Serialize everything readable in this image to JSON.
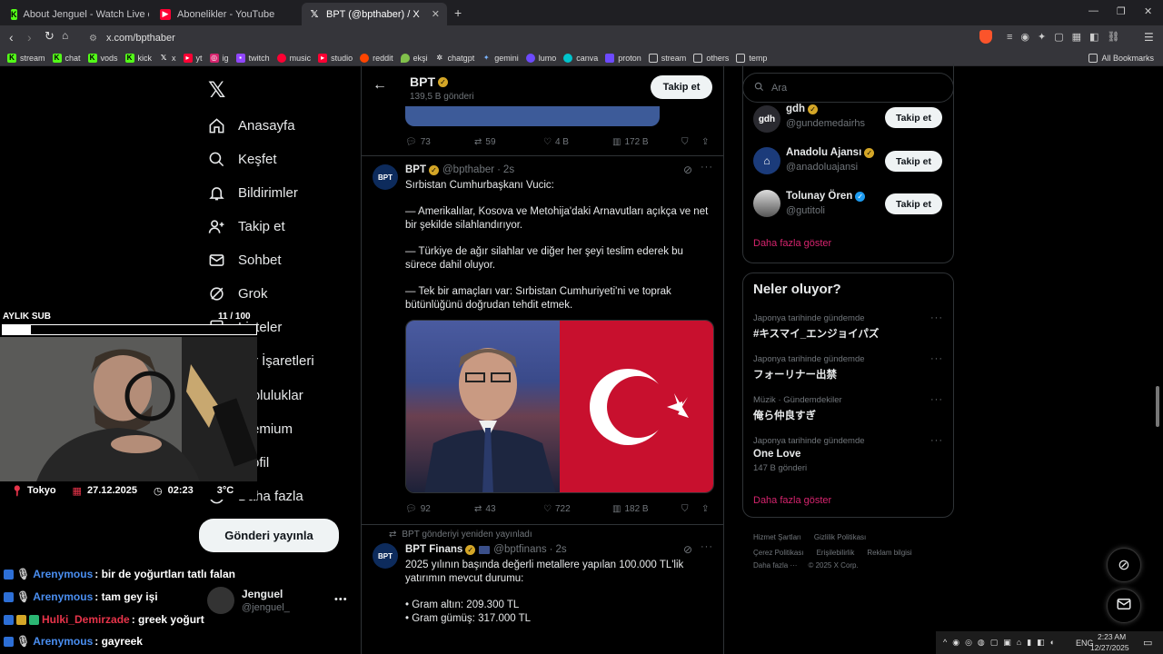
{
  "browser": {
    "tabs": [
      {
        "title": "About Jenguel - Watch Live on Kick",
        "icon": "kick-icon",
        "color": "#53fc18"
      },
      {
        "title": "Abonelikler - YouTube",
        "icon": "youtube-icon",
        "color": "#ff0033"
      },
      {
        "title": "BPT (@bpthaber) / X",
        "icon": "x-icon",
        "color": "#ffffff"
      }
    ],
    "url": "x.com/bpthaber",
    "bookmarks": [
      "stream",
      "chat",
      "vods",
      "kick",
      "x",
      "yt",
      "ig",
      "twitch",
      "music",
      "studio",
      "reddit",
      "ekşi",
      "chatgpt",
      "gemini",
      "lumo",
      "canva",
      "proton",
      "stream",
      "others",
      "temp"
    ],
    "all_bookmarks": "All Bookmarks"
  },
  "nav": {
    "items": [
      "Anasayfa",
      "Keşfet",
      "Bildirimler",
      "Takip et",
      "Sohbet",
      "Grok",
      "Listeler",
      "Yer İşaretleri",
      "Topluluklar",
      "Premium",
      "Profil",
      "Daha fazla"
    ],
    "post_button": "Gönderi yayınla",
    "account_name": "Jenguel",
    "account_handle": "@jenguel_"
  },
  "profile_header": {
    "name": "BPT",
    "posts": "139,5 B gönderi",
    "follow": "Takip et"
  },
  "tweets": [
    {
      "stats": {
        "replies": "73",
        "retweets": "59",
        "likes": "4 B",
        "views": "172 B"
      }
    },
    {
      "name": "BPT",
      "handle": "@bpthaber",
      "time": "2s",
      "avatar_text": "BPT",
      "lines": [
        "Sırbistan Cumhurbaşkanı Vucic:",
        "— Amerikalılar, Kosova ve Metohija'daki Arnavutları açıkça ve net bir şekilde silahlandırıyor.",
        "— Türkiye de ağır silahlar ve diğer her şeyi teslim ederek bu sürece dahil oluyor.",
        "— Tek bir amaçları var: Sırbistan Cumhuriyeti'ni ve toprak bütünlüğünü doğrudan tehdit etmek."
      ],
      "stats": {
        "replies": "92",
        "retweets": "43",
        "likes": "722",
        "views": "182 B"
      }
    },
    {
      "repost_note": "BPT gönderiyi yeniden yayınladı",
      "name": "BPT Finans",
      "handle": "@bptfinans",
      "time": "2s",
      "avatar_text": "BPT",
      "lines": [
        "2025 yılının başında değerli metallere yapılan 100.000 TL'lik yatırımın mevcut durumu:",
        "• Gram altın: 209.300 TL",
        "• Gram gümüş: 317.000 TL"
      ]
    }
  ],
  "search": {
    "placeholder": "Ara"
  },
  "who_to_follow": [
    {
      "name": "gdh",
      "handle": "@gundemedairhs",
      "badge": "gold",
      "follow": "Takip et"
    },
    {
      "name": "Anadolu Ajansı",
      "handle": "@anadoluajansi",
      "badge": "gold",
      "follow": "Takip et"
    },
    {
      "name": "Tolunay Ören",
      "handle": "@gutitoli",
      "badge": "blue",
      "follow": "Takip et"
    }
  ],
  "show_more_1": "Daha fazla göster",
  "trends_title": "Neler oluyor?",
  "trends": [
    {
      "category": "Japonya tarihinde gündemde",
      "name": "#キスマイ_エンジョイパズ",
      "posts": ""
    },
    {
      "category": "Japonya tarihinde gündemde",
      "name": "フォーリナー出禁",
      "posts": ""
    },
    {
      "category": "Müzik · Gündemdekiler",
      "name": "俺ら仲良すぎ",
      "posts": ""
    },
    {
      "category": "Japonya tarihinde gündemde",
      "name": "One Love",
      "posts": "147 B gönderi"
    }
  ],
  "show_more_2": "Daha fazla göster",
  "footer": {
    "line1": [
      "Hizmet Şartları",
      "Gizlilik Politikası"
    ],
    "line2": [
      "Çerez Politikası",
      "Erişilebilirlik",
      "Reklam bilgisi"
    ],
    "line3": [
      "Daha fazla ···",
      "© 2025 X Corp."
    ]
  },
  "stream": {
    "sub_label": "AYLIK SUB",
    "sub_count": "11 / 100",
    "sub_progress": 0.11,
    "location": "Tokyo",
    "date": "27.12.2025",
    "time": "02:23",
    "temp": "3°C",
    "chat": [
      {
        "user": "Arenymous",
        "color": "#4a8ef0",
        "message": ": bir de yoğurtları tatlı falan"
      },
      {
        "user": "Arenymous",
        "color": "#4a8ef0",
        "message": ": tam gey işi"
      },
      {
        "user": "Hulki_Demirzade",
        "color": "#e8344a",
        "message": ": greek yoğurt"
      },
      {
        "user": "Arenymous",
        "color": "#4a8ef0",
        "message": ": gayreek"
      }
    ]
  },
  "taskbar": {
    "lang": "ENG",
    "time": "2:23 AM",
    "date": "12/27/2025"
  }
}
